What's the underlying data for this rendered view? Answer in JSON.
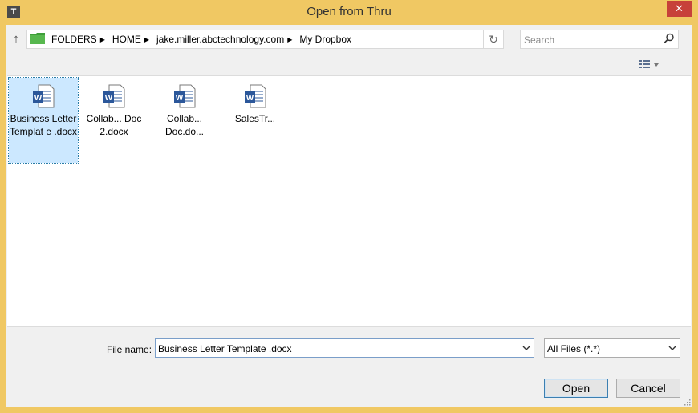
{
  "window": {
    "app_icon_letter": "T",
    "title": "Open from Thru",
    "close_glyph": "✕"
  },
  "navigation": {
    "up_glyph": "↑",
    "breadcrumbs": [
      "FOLDERS",
      "HOME",
      "jake.miller.abctechnology.com",
      "My Dropbox"
    ],
    "refresh_glyph": "↻"
  },
  "search": {
    "placeholder": "Search"
  },
  "files": [
    {
      "label": "Business Letter Templat e .docx",
      "selected": true
    },
    {
      "label": "Collab... Doc 2.docx",
      "selected": false
    },
    {
      "label": "Collab... Doc.do...",
      "selected": false
    },
    {
      "label": "SalesTr...",
      "selected": false
    }
  ],
  "footer": {
    "file_name_label": "File name:",
    "file_name_value": "Business Letter Template .docx",
    "file_type_value": "All Files (*.*)",
    "open_label": "Open",
    "cancel_label": "Cancel"
  },
  "colors": {
    "title_bar": "#f0c863",
    "close_button": "#c7413a",
    "selection": "#cce8ff",
    "word_blue": "#2b579a"
  },
  "icons": {
    "folder": "folder-icon",
    "document": "word-document-icon",
    "search": "search-icon",
    "view": "details-view-icon"
  }
}
